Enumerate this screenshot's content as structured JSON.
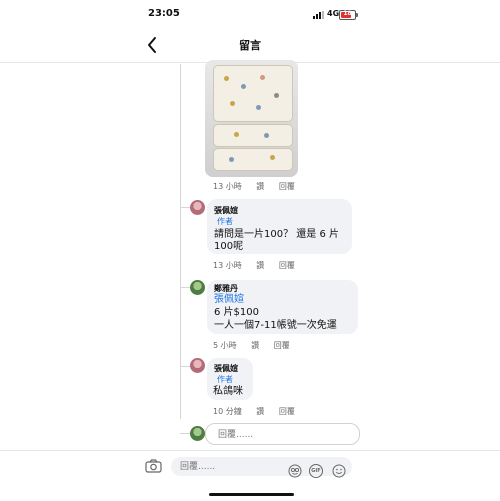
{
  "status_bar": {
    "time": "23:05",
    "network": "4G",
    "battery": "18"
  },
  "header": {
    "back_icon": "chevron-left-icon",
    "title": "留言"
  },
  "photo_comment": {
    "time": "13 小時",
    "like_label": "讚",
    "reply_label": "回覆"
  },
  "comments": [
    {
      "author": "張佩媗",
      "badge": "作者",
      "lines": [
        "請問是一片100？ 還是 6 片",
        "100呢"
      ],
      "time": "13 小時",
      "like_label": "讚",
      "reply_label": "回覆"
    },
    {
      "author": "鄭雅丹",
      "mention": "張佩媗",
      "lines": [
        "6 片$100",
        "一人一個7-11帳號一次免運"
      ],
      "time": "5 小時",
      "like_label": "讚",
      "reply_label": "回覆"
    },
    {
      "author": "張佩媗",
      "badge": "作者",
      "lines": [
        "私鴿咪"
      ],
      "time": "10 分鐘",
      "like_label": "讚",
      "reply_label": "回覆"
    }
  ],
  "reply_box": {
    "placeholder": "回覆......"
  },
  "bottom_bar": {
    "camera_icon": "camera-icon",
    "placeholder": "回覆......",
    "gif_label": "GIF",
    "icons": [
      "avatar-sticker-icon",
      "gif-icon",
      "emoji-icon"
    ]
  }
}
